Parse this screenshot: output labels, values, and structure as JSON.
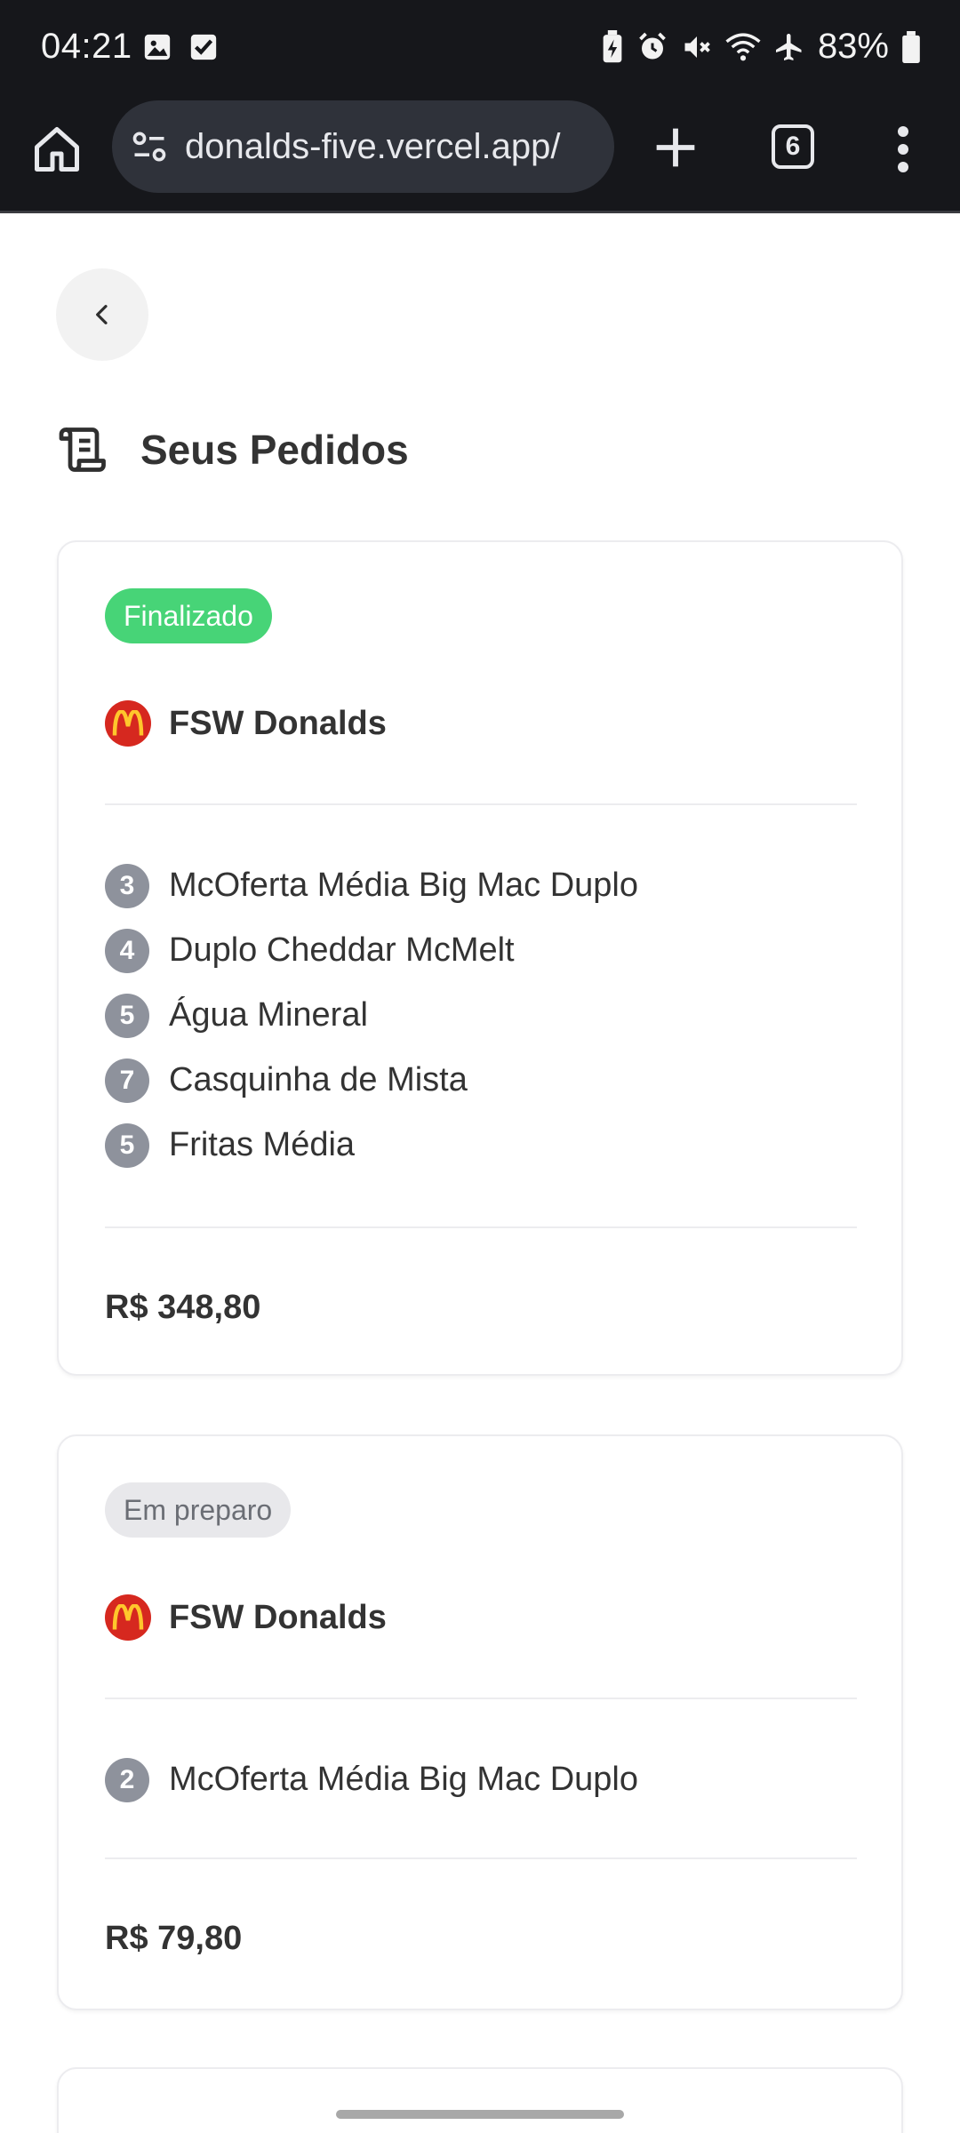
{
  "status_bar": {
    "time": "04:21",
    "battery_percent": "83%",
    "left_icons": [
      "image-icon",
      "checkbox-icon"
    ],
    "right_icons": [
      "battery-saver-icon",
      "alarm-icon",
      "mute-icon",
      "wifi-icon",
      "airplane-icon",
      "battery-icon"
    ]
  },
  "browser": {
    "url": "donalds-five.vercel.app/",
    "tab_count": "6"
  },
  "page": {
    "title": "Seus Pedidos"
  },
  "orders": [
    {
      "status": "Finalizado",
      "restaurant": "FSW Donalds",
      "items": [
        {
          "qty": "3",
          "name": "McOferta Média Big Mac Duplo"
        },
        {
          "qty": "4",
          "name": "Duplo Cheddar McMelt"
        },
        {
          "qty": "5",
          "name": "Água Mineral"
        },
        {
          "qty": "7",
          "name": "Casquinha de Mista"
        },
        {
          "qty": "5",
          "name": "Fritas Média"
        }
      ],
      "total": "R$ 348,80"
    },
    {
      "status": "Em preparo",
      "restaurant": "FSW Donalds",
      "items": [
        {
          "qty": "2",
          "name": "McOferta Média Big Mac Duplo"
        }
      ],
      "total": "R$ 79,80"
    }
  ],
  "colors": {
    "finalizado_badge": "#47d477",
    "em_preparo_badge": "#e8e8eb",
    "qty_badge": "#8e929c",
    "logo_red": "#d6281f",
    "logo_yellow": "#ffc72c"
  }
}
